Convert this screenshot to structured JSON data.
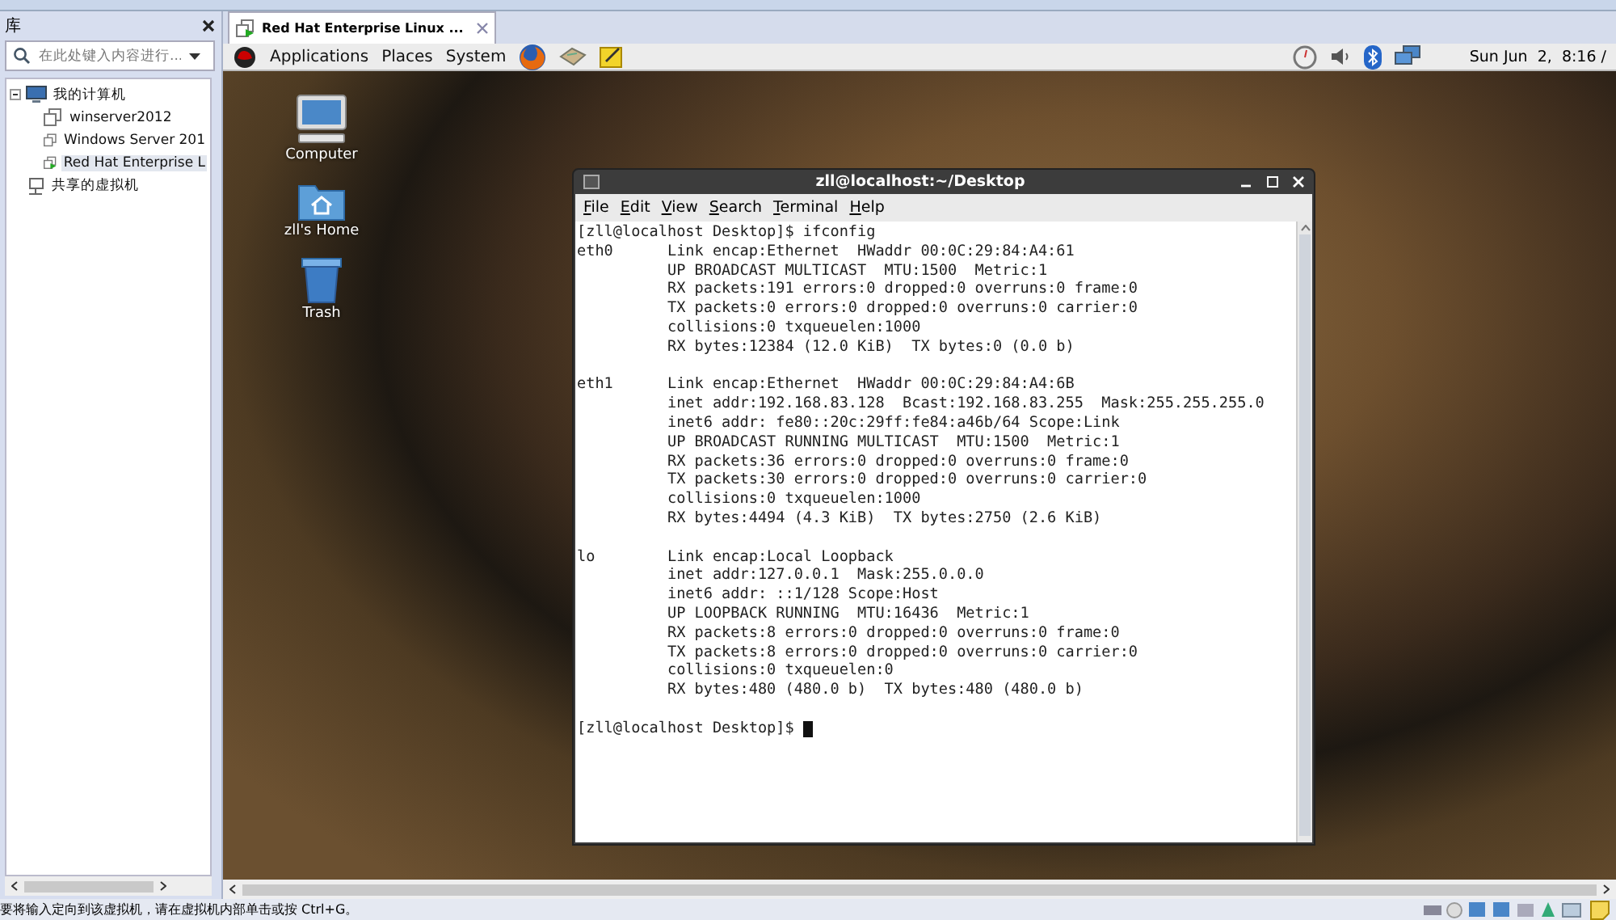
{
  "library": {
    "title": "库",
    "search": {
      "placeholder": "在此处键入内容进行..."
    },
    "tree": [
      {
        "label": "我的计算机",
        "kind": "computer",
        "expanded": true,
        "selected": false,
        "children": [
          {
            "label": "winserver2012",
            "kind": "vm",
            "running": false,
            "selected": false
          },
          {
            "label": "Windows Server 201",
            "kind": "vm",
            "running": false,
            "selected": false
          },
          {
            "label": "Red Hat Enterprise L",
            "kind": "vm",
            "running": true,
            "selected": true
          }
        ]
      },
      {
        "label": "共享的虚拟机",
        "kind": "shared",
        "selected": false
      }
    ]
  },
  "tabs": [
    {
      "label": "Red Hat Enterprise Linux ...",
      "selected": true
    }
  ],
  "guest": {
    "panel": {
      "menus": [
        "Applications",
        "Places",
        "System"
      ],
      "clock": "Sun Jun  2,  8:16 /"
    },
    "desktop_icons": [
      {
        "label": "Computer",
        "kind": "computer"
      },
      {
        "label": "zll's Home",
        "kind": "home"
      },
      {
        "label": "Trash",
        "kind": "trash"
      }
    ],
    "terminal": {
      "title": "zll@localhost:~/Desktop",
      "menus": [
        "File",
        "Edit",
        "View",
        "Search",
        "Terminal",
        "Help"
      ],
      "blocks": [
        [
          "[zll@localhost Desktop]$ ifconfig",
          "eth0      Link encap:Ethernet  HWaddr 00:0C:29:84:A4:61",
          "          UP BROADCAST MULTICAST  MTU:1500  Metric:1",
          "          RX packets:191 errors:0 dropped:0 overruns:0 frame:0",
          "          TX packets:0 errors:0 dropped:0 overruns:0 carrier:0",
          "          collisions:0 txqueuelen:1000",
          "          RX bytes:12384 (12.0 KiB)  TX bytes:0 (0.0 b)"
        ],
        [
          "eth1      Link encap:Ethernet  HWaddr 00:0C:29:84:A4:6B",
          "          inet addr:192.168.83.128  Bcast:192.168.83.255  Mask:255.255.255.0",
          "          inet6 addr: fe80::20c:29ff:fe84:a46b/64 Scope:Link",
          "          UP BROADCAST RUNNING MULTICAST  MTU:1500  Metric:1",
          "          RX packets:36 errors:0 dropped:0 overruns:0 frame:0",
          "          TX packets:30 errors:0 dropped:0 overruns:0 carrier:0",
          "          collisions:0 txqueuelen:1000",
          "          RX bytes:4494 (4.3 KiB)  TX bytes:2750 (2.6 KiB)"
        ],
        [
          "lo        Link encap:Local Loopback",
          "          inet addr:127.0.0.1  Mask:255.0.0.0",
          "          inet6 addr: ::1/128 Scope:Host",
          "          UP LOOPBACK RUNNING  MTU:16436  Metric:1",
          "          RX packets:8 errors:0 dropped:0 overruns:0 frame:0",
          "          TX packets:8 errors:0 dropped:0 overruns:0 carrier:0",
          "          collisions:0 txqueuelen:0",
          "          RX bytes:480 (480.0 b)  TX bytes:480 (480.0 b)"
        ],
        [
          "[zll@localhost Desktop]$"
        ]
      ]
    }
  },
  "status_bar": {
    "message": "要将输入定向到该虚拟机，请在虚拟机内部单击或按 Ctrl+G。"
  }
}
